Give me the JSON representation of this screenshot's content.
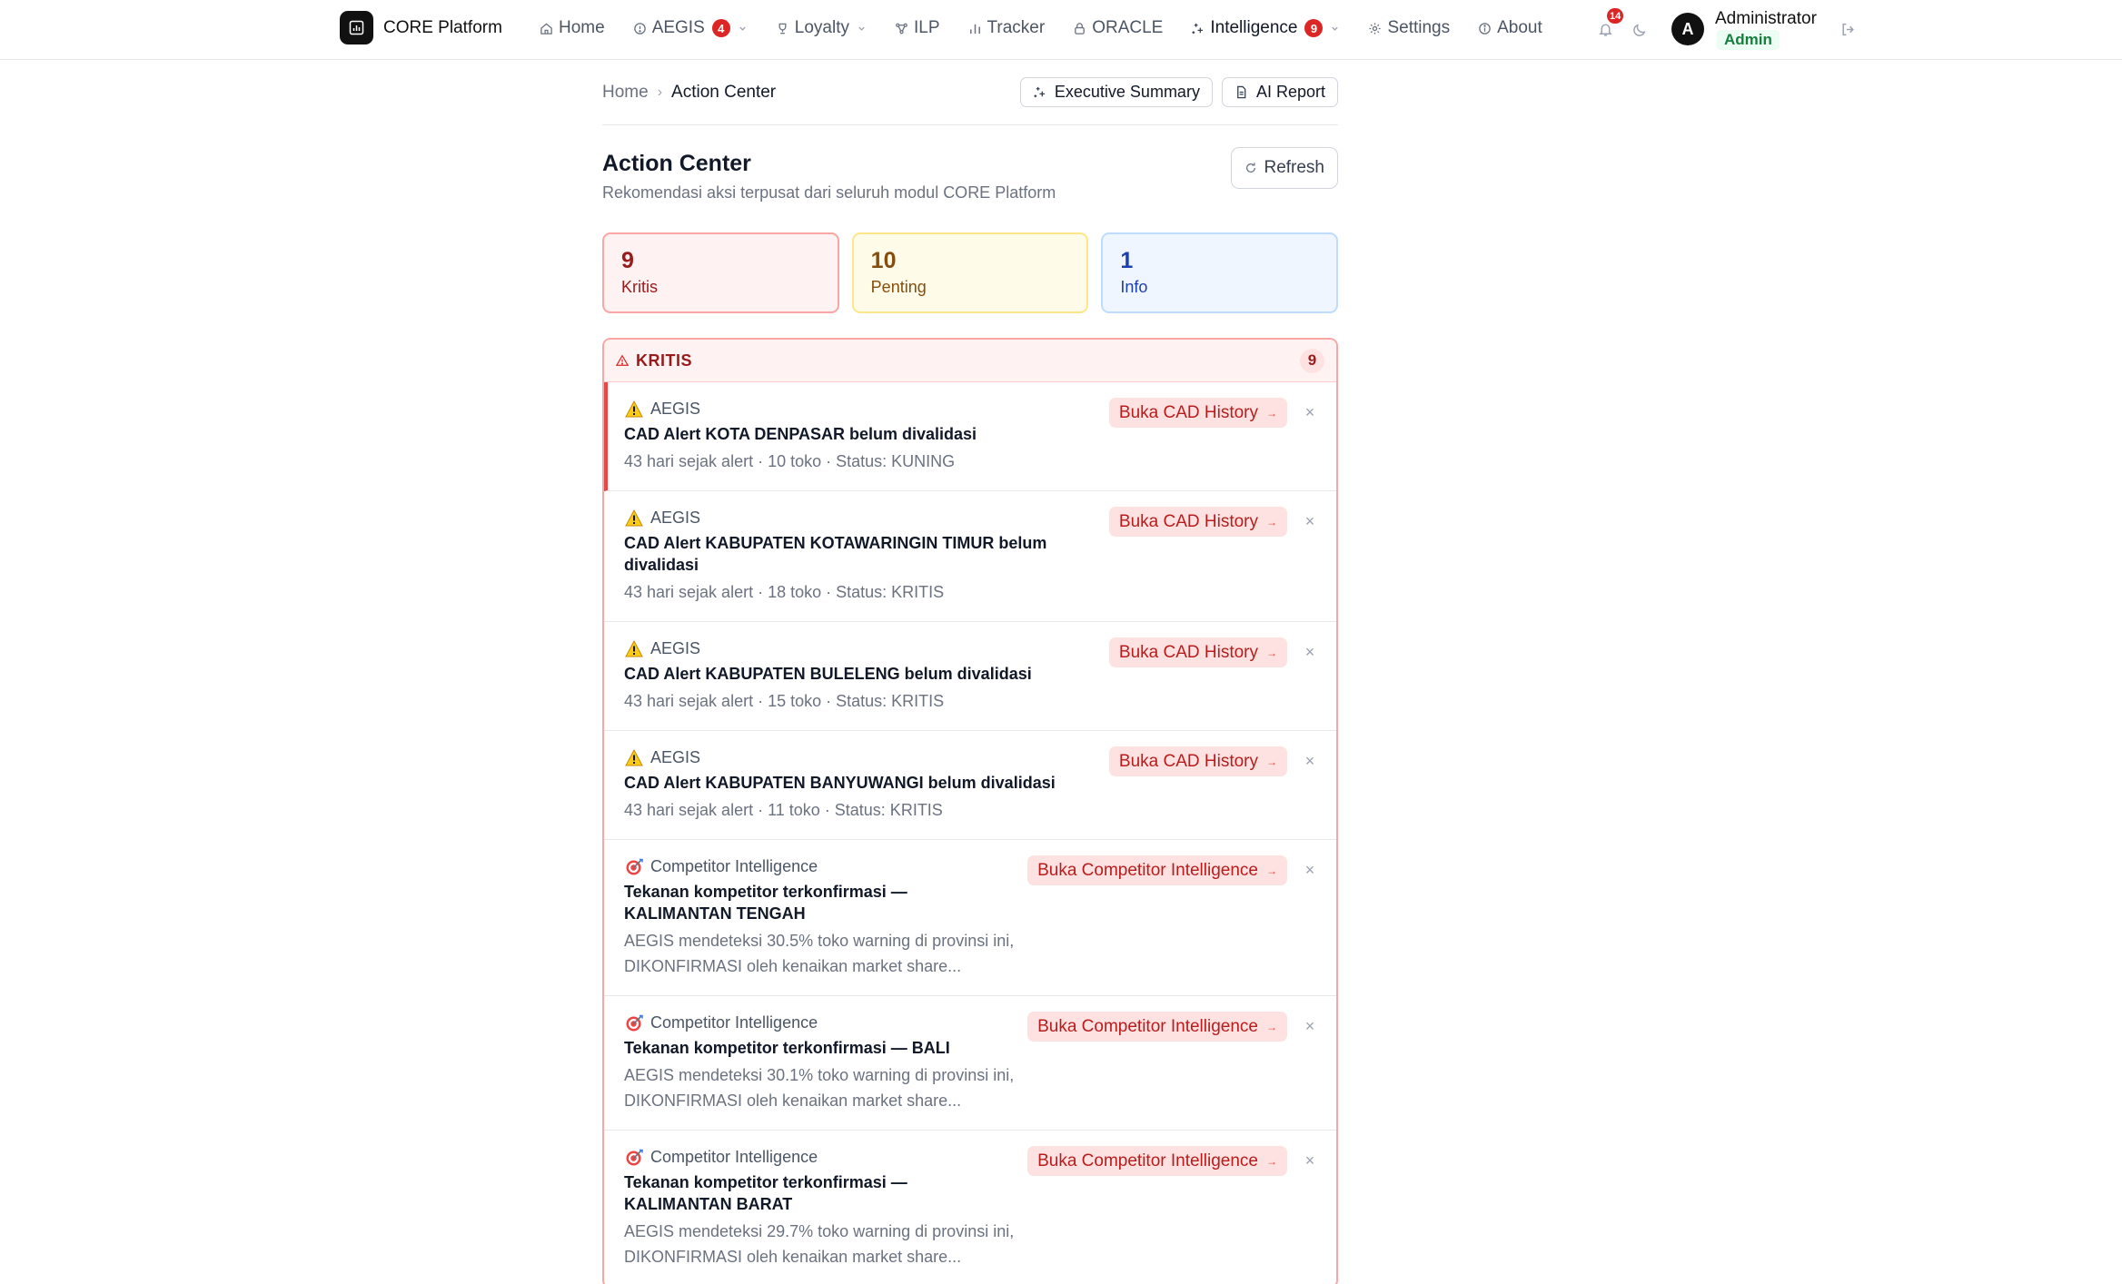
{
  "brand": {
    "name": "CORE Platform"
  },
  "nav": {
    "home": "Home",
    "aegis": "AEGIS",
    "aegis_badge": "4",
    "loyalty": "Loyalty",
    "ilp": "ILP",
    "tracker": "Tracker",
    "oracle": "ORACLE",
    "intelligence": "Intelligence",
    "intelligence_badge": "9",
    "settings": "Settings",
    "about": "About"
  },
  "user": {
    "notifications": "14",
    "avatar_initial": "A",
    "name": "Administrator",
    "role": "Admin"
  },
  "breadcrumb": {
    "home": "Home",
    "current": "Action Center"
  },
  "header_actions": {
    "executive_summary": "Executive Summary",
    "ai_report": "AI Report"
  },
  "page": {
    "title": "Action Center",
    "subtitle": "Rekomendasi aksi terpusat dari seluruh modul CORE Platform",
    "refresh": "Refresh"
  },
  "stats": {
    "critical": {
      "count": "9",
      "label": "Kritis"
    },
    "important": {
      "count": "10",
      "label": "Penting"
    },
    "info": {
      "count": "1",
      "label": "Info"
    }
  },
  "critical_section": {
    "title": "KRITIS",
    "count": "9",
    "items": [
      {
        "module": "AEGIS",
        "title": "CAD Alert KOTA DENPASAR belum divalidasi",
        "meta": "43 hari sejak alert · 10 toko · Status: KUNING",
        "action": "Buka CAD History"
      },
      {
        "module": "AEGIS",
        "title": "CAD Alert KABUPATEN KOTAWARINGIN TIMUR belum divalidasi",
        "meta": "43 hari sejak alert · 18 toko · Status: KRITIS",
        "action": "Buka CAD History"
      },
      {
        "module": "AEGIS",
        "title": "CAD Alert KABUPATEN BULELENG belum divalidasi",
        "meta": "43 hari sejak alert · 15 toko · Status: KRITIS",
        "action": "Buka CAD History"
      },
      {
        "module": "AEGIS",
        "title": "CAD Alert KABUPATEN BANYUWANGI belum divalidasi",
        "meta": "43 hari sejak alert · 11 toko · Status: KRITIS",
        "action": "Buka CAD History"
      },
      {
        "module": "Competitor Intelligence",
        "title": "Tekanan kompetitor terkonfirmasi — KALIMANTAN TENGAH",
        "meta": "AEGIS mendeteksi 30.5% toko warning di provinsi ini, DIKONFIRMASI oleh kenaikan market share...",
        "action": "Buka Competitor Intelligence"
      },
      {
        "module": "Competitor Intelligence",
        "title": "Tekanan kompetitor terkonfirmasi — BALI",
        "meta": "AEGIS mendeteksi 30.1% toko warning di provinsi ini, DIKONFIRMASI oleh kenaikan market share...",
        "action": "Buka Competitor Intelligence"
      },
      {
        "module": "Competitor Intelligence",
        "title": "Tekanan kompetitor terkonfirmasi — KALIMANTAN BARAT",
        "meta": "AEGIS mendeteksi 29.7% toko warning di provinsi ini, DIKONFIRMASI oleh kenaikan market share...",
        "action": "Buka Competitor Intelligence"
      }
    ]
  },
  "dismiss_label": "×"
}
